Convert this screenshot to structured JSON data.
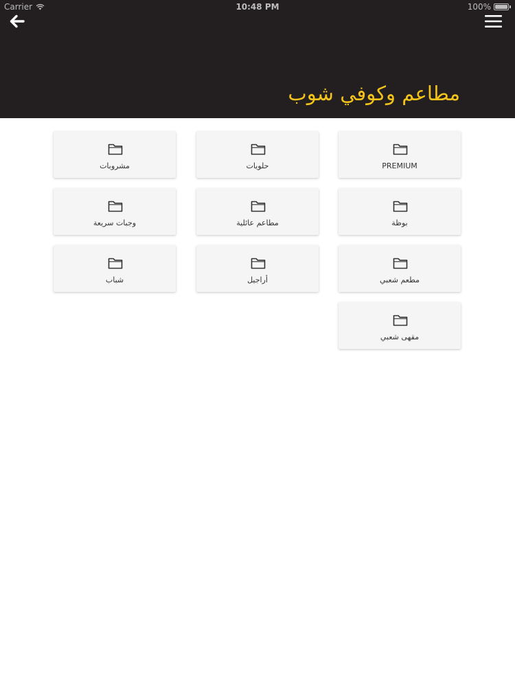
{
  "status_bar": {
    "carrier": "Carrier",
    "time": "10:48 PM",
    "battery": "100%",
    "battery_level": 1.0
  },
  "header": {
    "title": "مطاعم وكوفي شوب",
    "title_color": "#f2c31a",
    "background_color": "#231f20",
    "back_icon": "arrow-left-icon",
    "menu_icon": "hamburger-menu-icon"
  },
  "categories": [
    {
      "label": "PREMIUM",
      "icon": "folder-icon"
    },
    {
      "label": "حلويات",
      "icon": "folder-icon"
    },
    {
      "label": "مشروبات",
      "icon": "folder-icon"
    },
    {
      "label": "بوظة",
      "icon": "folder-icon"
    },
    {
      "label": "مطاعم عائلية",
      "icon": "folder-icon"
    },
    {
      "label": "وجبات سريعة",
      "icon": "folder-icon"
    },
    {
      "label": "مطعم شعبي",
      "icon": "folder-icon"
    },
    {
      "label": "أراجيل",
      "icon": "folder-icon"
    },
    {
      "label": "شباب",
      "icon": "folder-icon"
    },
    {
      "label": "مقهى شعبي",
      "icon": "folder-icon"
    }
  ]
}
